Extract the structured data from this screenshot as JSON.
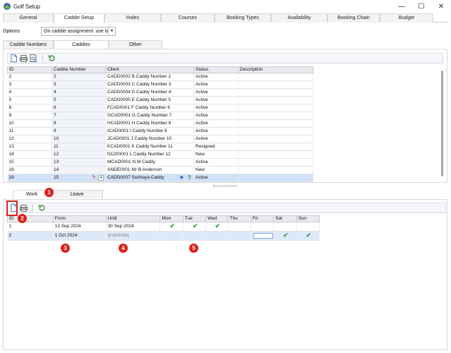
{
  "window": {
    "title": "Golf Setup",
    "minimize": "—",
    "maximize": "☐",
    "close": "✕"
  },
  "main_tabs": [
    "General",
    "Caddie Setup",
    "Holes",
    "Courses",
    "Booking Types",
    "Availability",
    "Booking Chain",
    "Budget"
  ],
  "options": {
    "label": "Options",
    "value": "On caddie assignment: use las"
  },
  "sub_tabs": [
    "Caddie Numbers",
    "Caddies",
    "Other"
  ],
  "caddies_table": {
    "headers": [
      "ID",
      "Caddie Number",
      "Client",
      "Status",
      "Description"
    ],
    "rows": [
      [
        "2",
        "2",
        "CADD0002 B Caddy Number 2",
        "Active",
        ""
      ],
      [
        "3",
        "3",
        "CADD0003 C Caddy Number 3",
        "Active",
        ""
      ],
      [
        "4",
        "4",
        "CADD0004 D Caddy Number 4",
        "Active",
        ""
      ],
      [
        "5",
        "5",
        "CADD0005 E Caddy Number 5",
        "Active",
        ""
      ],
      [
        "8",
        "6",
        "FCAD0001 F Caddy Number 6",
        "Active",
        ""
      ],
      [
        "9",
        "7",
        "GCAD0001 G Caddy Number 7",
        "Active",
        ""
      ],
      [
        "10",
        "8",
        "HCAD0001 H Caddy Number 8",
        "Active",
        ""
      ],
      [
        "11",
        "9",
        "ICAD0001 I Caddy Number 9",
        "Active",
        ""
      ],
      [
        "12",
        "10",
        "JCAD0001 J Caddy Number 10",
        "Active",
        ""
      ],
      [
        "13",
        "11",
        "KCAD0001 K Caddy Number 11",
        "Resigned",
        ""
      ],
      [
        "14",
        "12",
        "N1200001 L Caddy Number 12",
        "New",
        ""
      ],
      [
        "15",
        "13",
        "MCAD0001 N M Caddy",
        "Active",
        ""
      ],
      [
        "16",
        "14",
        "ANDE0001 Mr B Anderson",
        "New",
        ""
      ],
      [
        "19",
        "15",
        "CADD0007 Suchaya Caddy",
        "Active",
        ""
      ]
    ]
  },
  "bottom_tabs": [
    "Work",
    "Leave"
  ],
  "work_table": {
    "headers": [
      "ID",
      "From",
      "Until",
      "Mon",
      "Tue",
      "Wed",
      "Thu",
      "Fri",
      "Sat",
      "Sun"
    ],
    "rows": [
      {
        "id": "1",
        "from": "13 Sep 2024",
        "until": "30 Sep 2024",
        "days": [
          "✔",
          "✔",
          "✔",
          "",
          "",
          "",
          ""
        ]
      },
      {
        "id": "2",
        "from": "1 Oct 2024",
        "until": "[Indefinite]",
        "days": [
          "",
          "",
          "",
          "",
          "",
          "✔",
          "✔"
        ]
      }
    ]
  },
  "badges": [
    "1",
    "2",
    "3",
    "4",
    "5"
  ],
  "colors": {
    "accent": "#1e73be",
    "badge": "#d8231c",
    "check": "#3c9a3c",
    "selection": "#cfe0f7"
  }
}
